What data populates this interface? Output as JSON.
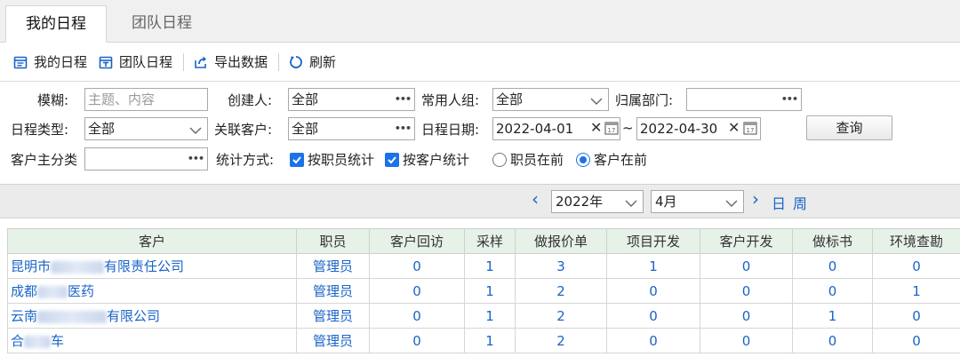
{
  "tabs": [
    {
      "label": "我的日程",
      "active": true
    },
    {
      "label": "团队日程",
      "active": false
    }
  ],
  "toolbar": {
    "my_schedule": "我的日程",
    "team_schedule": "团队日程",
    "export": "导出数据",
    "refresh": "刷新"
  },
  "filters": {
    "fuzzy_label": "模糊:",
    "fuzzy_placeholder": "主题、内容",
    "creator_label": "创建人:",
    "creator_value": "全部",
    "group_label": "常用人组:",
    "group_value": "全部",
    "dept_label": "归属部门:",
    "dept_value": "",
    "type_label": "日程类型:",
    "type_value": "全部",
    "client_label": "关联客户:",
    "client_value": "全部",
    "date_label": "日程日期:",
    "date_from": "2022-04-01",
    "date_sep": "~",
    "date_to": "2022-04-30",
    "query_button": "查询",
    "category_label": "客户主分类",
    "category_value": "",
    "stat_label": "统计方式:",
    "by_staff": "按职员统计",
    "by_client": "按客户统计",
    "staff_first": "职员在前",
    "client_first": "客户在前",
    "staff_first_selected": false,
    "client_first_selected": true
  },
  "nav": {
    "prev": "‹",
    "year": "2022年",
    "month": "4月",
    "next": "›",
    "day": "日",
    "week": "周"
  },
  "table": {
    "headers": [
      "客户",
      "职员",
      "客户回访",
      "采样",
      "做报价单",
      "项目开发",
      "客户开发",
      "做标书",
      "环境查勘"
    ],
    "rows": [
      {
        "client_prefix": "昆明市",
        "client_suffix": "有限责任公司",
        "staff": "管理员",
        "values": [
          "0",
          "1",
          "3",
          "1",
          "0",
          "0",
          "0"
        ]
      },
      {
        "client_prefix": "成都",
        "client_suffix": "医药",
        "staff": "管理员",
        "values": [
          "0",
          "1",
          "2",
          "0",
          "0",
          "0",
          "1"
        ]
      },
      {
        "client_prefix": "云南",
        "client_suffix": "有限公司",
        "staff": "管理员",
        "values": [
          "0",
          "1",
          "2",
          "0",
          "0",
          "1",
          "0"
        ]
      },
      {
        "client_prefix": "合",
        "client_suffix": "车",
        "staff": "管理员",
        "values": [
          "0",
          "1",
          "2",
          "0",
          "0",
          "0",
          "0"
        ]
      }
    ]
  },
  "colors": {
    "accent": "#1a73e8",
    "link": "#1a64c8",
    "header_bg": "#e6f1e8"
  }
}
